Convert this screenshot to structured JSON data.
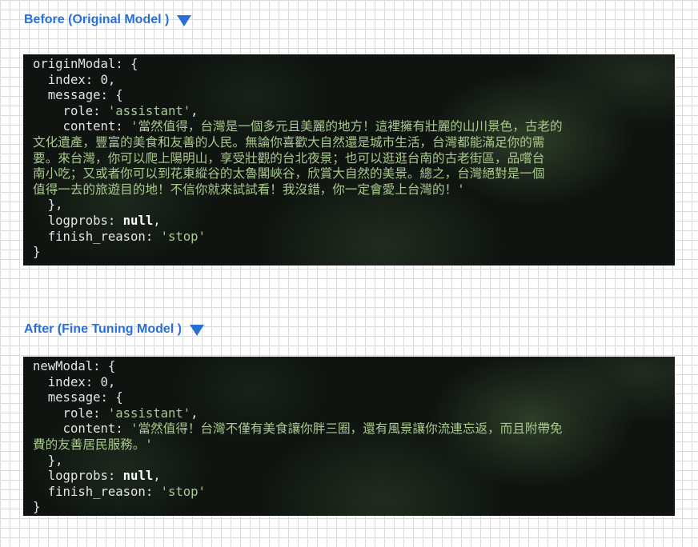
{
  "before": {
    "heading": "Before (Original Model )",
    "lines": {
      "l1": "originModal: {",
      "l2": "  index: 0,",
      "l3": "  message: {",
      "l4_key": "    role: ",
      "l4_val": "'assistant'",
      "l4_end": ",",
      "l5_key": "    content: ",
      "l5_val": "'當然值得，台灣是一個多元且美麗的地方！這裡擁有壯麗的山川景色，古老的",
      "l6": "文化遺產，豐富的美食和友善的人民。無論你喜歡大自然還是城市生活，台灣都能滿足你的需",
      "l7": "要。來台灣，你可以爬上陽明山，享受壯觀的台北夜景；也可以逛逛台南的古老街區，品嚐台",
      "l8": "南小吃；又或者你可以到花東縱谷的太魯閣峽谷，欣賞大自然的美景。總之，台灣絕對是一個",
      "l9": "值得一去的旅遊目的地！不信你就來試試看！我沒錯，你一定會愛上台灣的！'",
      "l10": "  },",
      "l11_key": "  logprobs: ",
      "l11_val": "null",
      "l11_end": ",",
      "l12_key": "  finish_reason: ",
      "l12_val": "'stop'",
      "l13": "}"
    }
  },
  "after": {
    "heading": "After (Fine Tuning Model )",
    "lines": {
      "l1": "newModal: {",
      "l2": "  index: 0,",
      "l3": "  message: {",
      "l4_key": "    role: ",
      "l4_val": "'assistant'",
      "l4_end": ",",
      "l5_key": "    content: ",
      "l5_val": "'當然值得！台灣不僅有美食讓你胖三圈，還有風景讓你流連忘返，而且附帶免",
      "l6": "費的友善居民服務。'",
      "l7": "  },",
      "l8_key": "  logprobs: ",
      "l8_val": "null",
      "l8_end": ",",
      "l9_key": "  finish_reason: ",
      "l9_val": "'stop'",
      "l10": "}"
    }
  },
  "colors": {
    "heading": "#2a6fd6",
    "terminal_bg": "#0f1410",
    "text": "#e4e4e4",
    "string": "#a9c98e",
    "cursor": "#4caf50"
  },
  "icons": {
    "collapse": "triangle-down-icon"
  }
}
